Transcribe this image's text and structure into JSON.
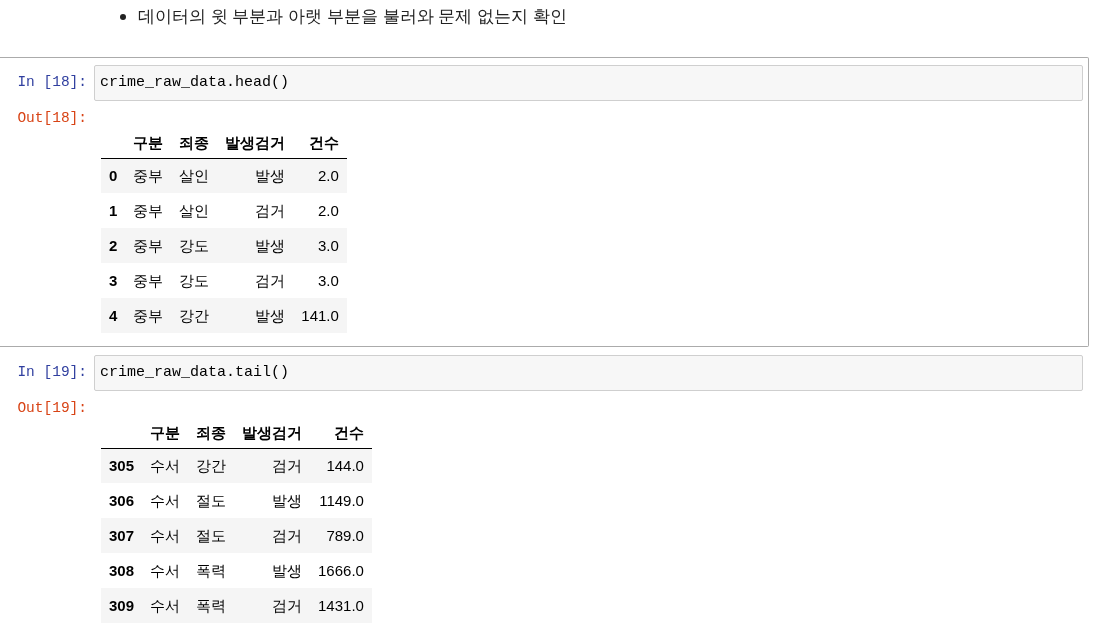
{
  "markdown": {
    "bullets": [
      "데이터의 윗 부분과 아랫 부분을 불러와 문제 없는지 확인"
    ]
  },
  "cells": [
    {
      "selected": true,
      "in_prompt": "In [18]:",
      "code": "crime_raw_data.head()",
      "out_prompt": "Out[18]:",
      "output_table": {
        "columns": [
          "구분",
          "죄종",
          "발생검거",
          "건수"
        ],
        "rows": [
          {
            "index": "0",
            "values": [
              "중부",
              "살인",
              "발생",
              "2.0"
            ]
          },
          {
            "index": "1",
            "values": [
              "중부",
              "살인",
              "검거",
              "2.0"
            ]
          },
          {
            "index": "2",
            "values": [
              "중부",
              "강도",
              "발생",
              "3.0"
            ]
          },
          {
            "index": "3",
            "values": [
              "중부",
              "강도",
              "검거",
              "3.0"
            ]
          },
          {
            "index": "4",
            "values": [
              "중부",
              "강간",
              "발생",
              "141.0"
            ]
          }
        ]
      }
    },
    {
      "selected": false,
      "in_prompt": "In [19]:",
      "code": "crime_raw_data.tail()",
      "out_prompt": "Out[19]:",
      "output_table": {
        "columns": [
          "구분",
          "죄종",
          "발생검거",
          "건수"
        ],
        "rows": [
          {
            "index": "305",
            "values": [
              "수서",
              "강간",
              "검거",
              "144.0"
            ]
          },
          {
            "index": "306",
            "values": [
              "수서",
              "절도",
              "발생",
              "1149.0"
            ]
          },
          {
            "index": "307",
            "values": [
              "수서",
              "절도",
              "검거",
              "789.0"
            ]
          },
          {
            "index": "308",
            "values": [
              "수서",
              "폭력",
              "발생",
              "1666.0"
            ]
          },
          {
            "index": "309",
            "values": [
              "수서",
              "폭력",
              "검거",
              "1431.0"
            ]
          }
        ]
      }
    }
  ]
}
